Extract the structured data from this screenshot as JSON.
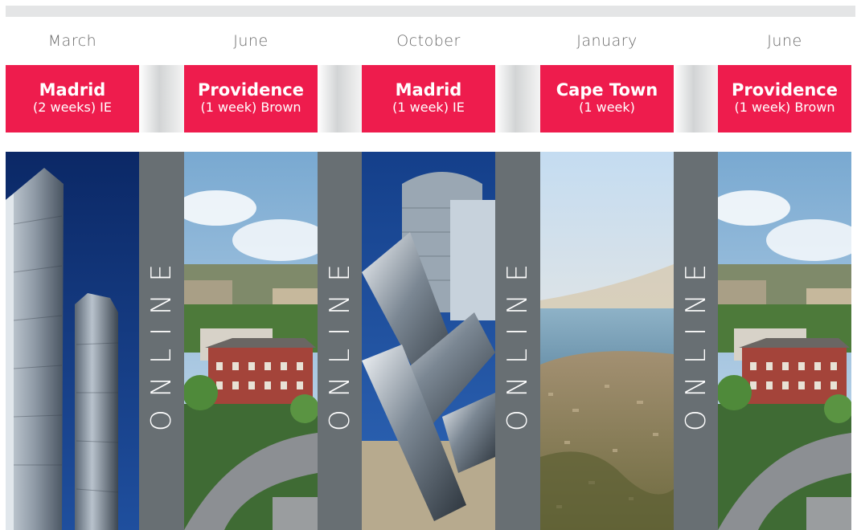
{
  "columns": [
    {
      "month": "March",
      "city": "Madrid",
      "detail": "(2 weeks) IE",
      "photo": "madrid-towers"
    },
    {
      "month": "June",
      "city": "Providence",
      "detail": "(1 week) Brown",
      "photo": "providence-campus"
    },
    {
      "month": "October",
      "city": "Madrid",
      "detail": "(1 week) IE",
      "photo": "madrid-sculpture"
    },
    {
      "month": "January",
      "city": "Cape Town",
      "detail": "(1 week)",
      "photo": "cape-town-aerial"
    },
    {
      "month": "June",
      "city": "Providence",
      "detail": "(1 week) Brown",
      "photo": "providence-campus"
    }
  ],
  "separator_label": "ONLINE",
  "colors": {
    "accent": "#ee1c4d",
    "online_band": "#686f73",
    "topbar": "#e4e5e6",
    "month_text": "#6a6a6a"
  }
}
